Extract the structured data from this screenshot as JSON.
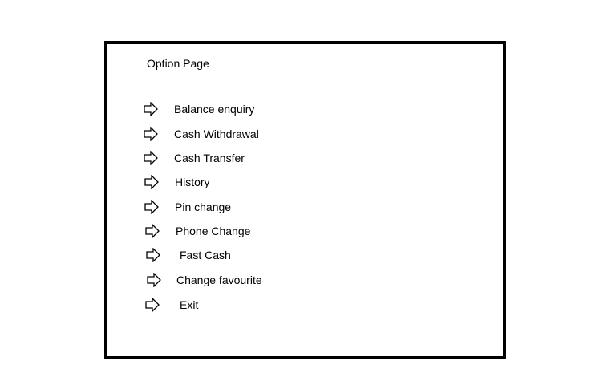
{
  "page": {
    "title": "Option Page"
  },
  "menu": {
    "items": [
      {
        "label": "Balance enquiry",
        "icon": "arrow-right-icon"
      },
      {
        "label": "Cash Withdrawal",
        "icon": "arrow-right-icon"
      },
      {
        "label": "Cash Transfer",
        "icon": "arrow-right-icon"
      },
      {
        "label": "History",
        "icon": "arrow-right-icon"
      },
      {
        "label": "Pin change",
        "icon": "arrow-right-icon"
      },
      {
        "label": "Phone Change",
        "icon": "arrow-right-icon"
      },
      {
        "label": "Fast Cash",
        "icon": "arrow-right-icon"
      },
      {
        "label": "Change favourite",
        "icon": "arrow-right-icon"
      },
      {
        "label": "Exit",
        "icon": "arrow-right-icon"
      }
    ]
  },
  "colors": {
    "background": "#ffffff",
    "border": "#000000",
    "text": "#000000"
  }
}
